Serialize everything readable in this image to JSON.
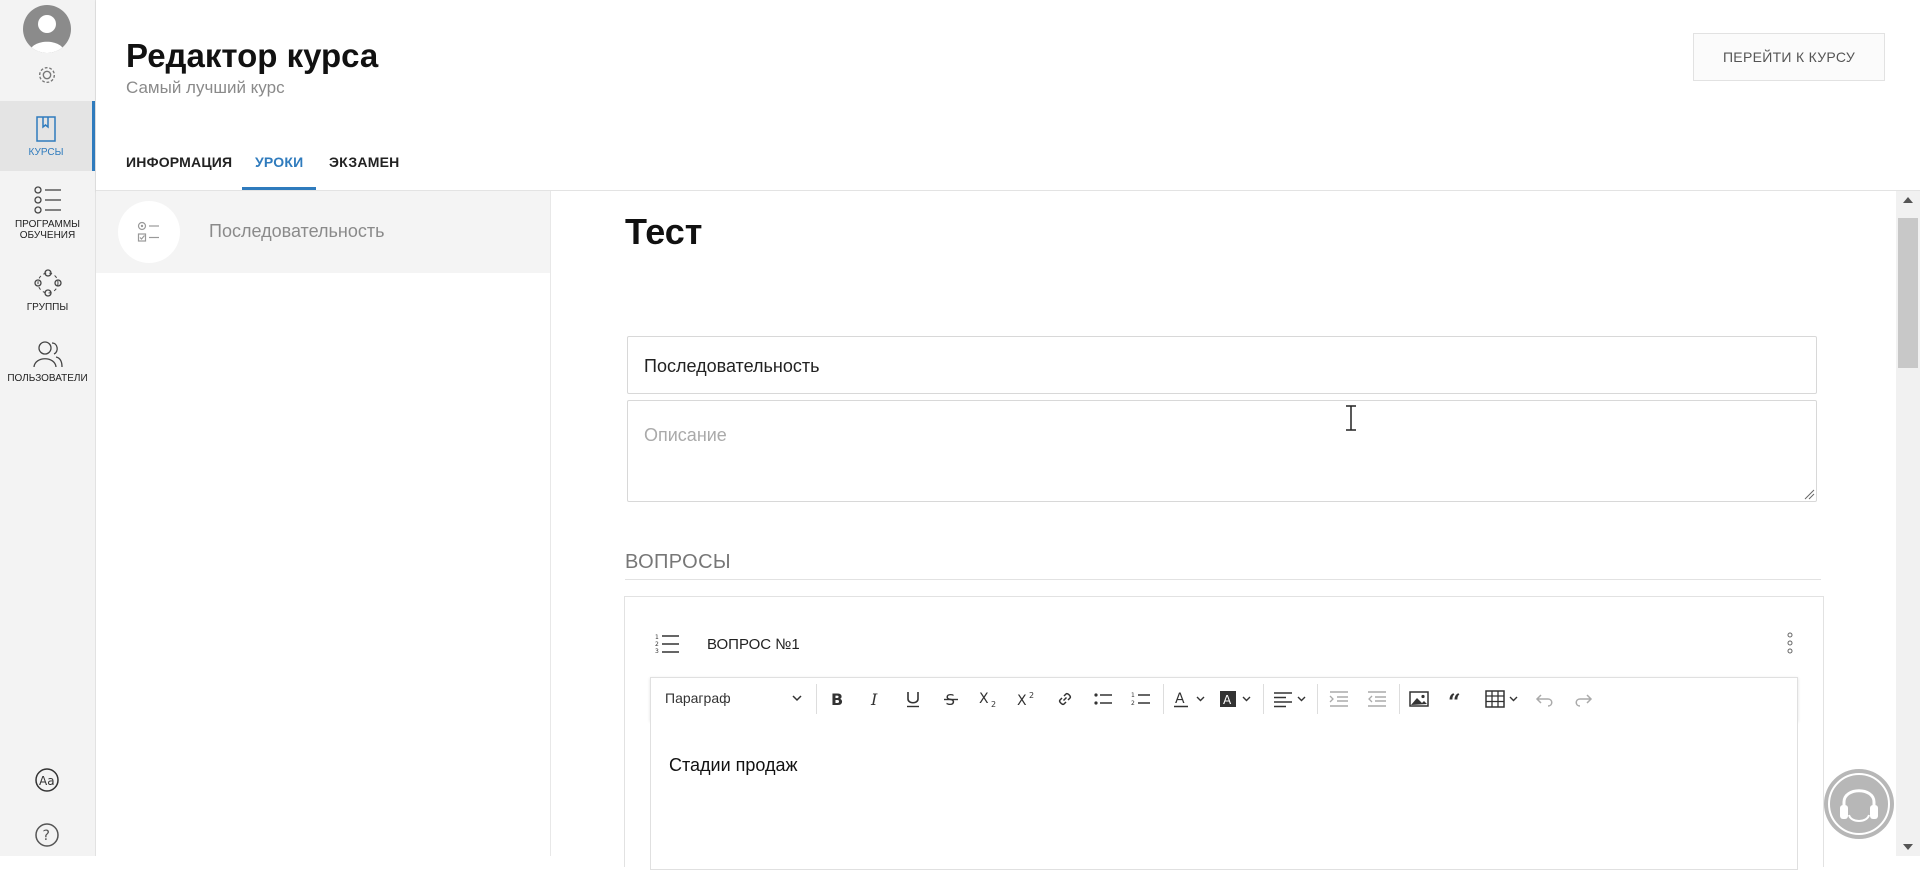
{
  "nav": {
    "items": [
      {
        "label": "КУРСЫ",
        "icon": "book-icon",
        "active": true
      },
      {
        "label": "ПРОГРАММЫ ОБУЧЕНИЯ",
        "icon": "checklist-icon",
        "active": false
      },
      {
        "label": "ГРУППЫ",
        "icon": "group-icon",
        "active": false
      },
      {
        "label": "ПОЛЬЗОВАТЕЛИ",
        "icon": "users-icon",
        "active": false
      }
    ],
    "icons": {
      "top": [
        "avatar-icon",
        "gear-icon"
      ],
      "bottom": [
        "font-size-icon",
        "help-icon"
      ]
    }
  },
  "header": {
    "title": "Редактор курса",
    "subtitle": "Самый лучший курс",
    "go_button": "ПЕРЕЙТИ К КУРСУ",
    "tabs": [
      {
        "label": "ИНФОРМАЦИЯ",
        "active": false
      },
      {
        "label": "УРОКИ",
        "active": true
      },
      {
        "label": "ЭКЗАМЕН",
        "active": false
      }
    ]
  },
  "lessons": {
    "items": [
      {
        "label": "Последовательность",
        "icon": "test-list-icon"
      }
    ]
  },
  "test": {
    "title": "Тест",
    "name_value": "Последовательность",
    "description_placeholder": "Описание",
    "questions_title": "ВОПРОСЫ",
    "question": {
      "label": "ВОПРОС №1",
      "icon": "ordered-list-icon",
      "text": "Стадии продаж"
    }
  },
  "toolbar": {
    "paragraph": "Параграф",
    "buttons": [
      "bold-icon",
      "italic-icon",
      "underline-icon",
      "strikethrough-icon",
      "subscript-icon",
      "superscript-icon",
      "link-icon",
      "bulleted-list-icon",
      "numbered-list-icon",
      "font-color-icon",
      "background-color-icon",
      "align-icon",
      "outdent-icon",
      "indent-icon",
      "image-icon",
      "quote-icon",
      "table-icon",
      "undo-icon",
      "redo-icon"
    ]
  },
  "colors": {
    "accent": "#2f7bbd",
    "nav_bg": "#f3f3f3"
  }
}
